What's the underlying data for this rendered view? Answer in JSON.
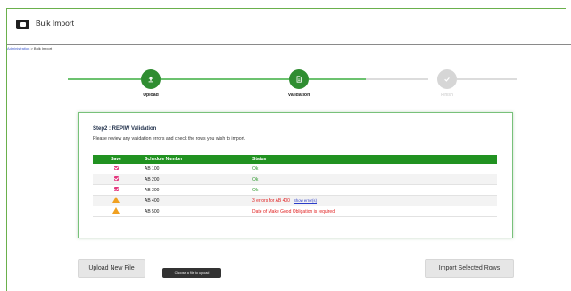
{
  "header": {
    "title": "Bulk Import",
    "icon": "import-icon"
  },
  "breadcrumb": {
    "root": "Administration",
    "separator": " > ",
    "current": "Bulk Import"
  },
  "stepper": {
    "steps": [
      {
        "label": "Upload",
        "icon": "upload-icon",
        "state": "complete"
      },
      {
        "label": "Validation",
        "icon": "document-icon",
        "state": "complete"
      },
      {
        "label": "Finish",
        "icon": "check-icon",
        "state": "pending"
      }
    ],
    "colors": {
      "complete": "#2f8d31",
      "pending": "#d6d6d6"
    }
  },
  "card": {
    "title": "Step2 : REPIW Validation",
    "description": "Please review any validation errors and check the rows you wish to import."
  },
  "table": {
    "headers": [
      "Save",
      "Schedule Number",
      "Status"
    ],
    "rows": [
      {
        "save": "checkbox-checked",
        "schedule": "AB 100",
        "status": "Ok",
        "status_type": "ok"
      },
      {
        "save": "checkbox-checked",
        "schedule": "AB 200",
        "status": "Ok",
        "status_type": "ok"
      },
      {
        "save": "checkbox-checked",
        "schedule": "AB 300",
        "status": "Ok",
        "status_type": "ok"
      },
      {
        "save": "warning-icon",
        "schedule": "AB 400",
        "status": "3 errors for AB 400",
        "link": "Show error(s)",
        "status_type": "error"
      },
      {
        "save": "warning-icon",
        "schedule": "AB 500",
        "status": "Date of Make Good Obligation is required",
        "status_type": "error"
      }
    ],
    "header_color": "#219221"
  },
  "buttons": {
    "upload": "Upload New File",
    "import": "Import Selected Rows"
  },
  "tooltip": "Choose a file to upload"
}
